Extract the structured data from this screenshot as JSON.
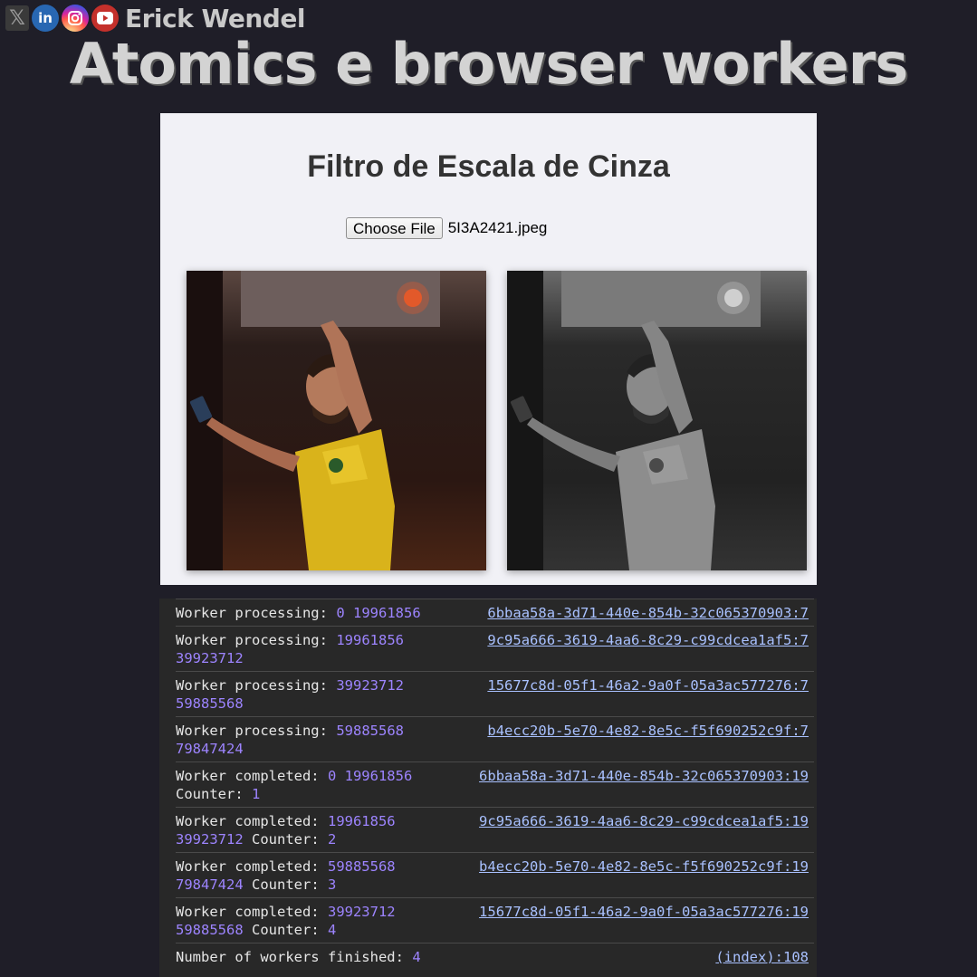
{
  "header": {
    "author": "Erick Wendel",
    "title": "Atomics e browser workers",
    "social_icons": [
      "x-icon",
      "linkedin-icon",
      "instagram-icon",
      "youtube-icon"
    ]
  },
  "page": {
    "heading": "Filtro de Escala de Cinza",
    "file_input": {
      "button_label": "Choose File",
      "file_name": "5I3A2421.jpeg"
    },
    "images": [
      "original-photo",
      "grayscale-photo"
    ]
  },
  "console": {
    "rows": [
      {
        "label": "Worker processing:",
        "nums": "0 19961856",
        "tail_label": "",
        "tail_num": "",
        "source": "6bbaa58a-3d71-440e-854b-32c065370903:7"
      },
      {
        "label": "Worker processing:",
        "nums": "19961856 39923712",
        "tail_label": "",
        "tail_num": "",
        "source": "9c95a666-3619-4aa6-8c29-c99cdcea1af5:7"
      },
      {
        "label": "Worker processing:",
        "nums": "39923712 59885568",
        "tail_label": "",
        "tail_num": "",
        "source": "15677c8d-05f1-46a2-9a0f-05a3ac577276:7"
      },
      {
        "label": "Worker processing:",
        "nums": "59885568 79847424",
        "tail_label": "",
        "tail_num": "",
        "source": "b4ecc20b-5e70-4e82-8e5c-f5f690252c9f:7"
      },
      {
        "label": "Worker completed:",
        "nums": "0 19961856",
        "tail_label": "Counter:",
        "tail_num": "1",
        "source": "6bbaa58a-3d71-440e-854b-32c065370903:19"
      },
      {
        "label": "Worker completed:",
        "nums": "19961856 39923712",
        "tail_label": "Counter:",
        "tail_num": "2",
        "source": "9c95a666-3619-4aa6-8c29-c99cdcea1af5:19"
      },
      {
        "label": "Worker completed:",
        "nums": "59885568 79847424",
        "tail_label": "Counter:",
        "tail_num": "3",
        "source": "b4ecc20b-5e70-4e82-8e5c-f5f690252c9f:19"
      },
      {
        "label": "Worker completed:",
        "nums": "39923712 59885568",
        "tail_label": "Counter:",
        "tail_num": "4",
        "source": "15677c8d-05f1-46a2-9a0f-05a3ac577276:19"
      },
      {
        "label": "Number of workers finished:",
        "nums": "4",
        "tail_label": "",
        "tail_num": "",
        "source": "(index):108"
      }
    ]
  }
}
